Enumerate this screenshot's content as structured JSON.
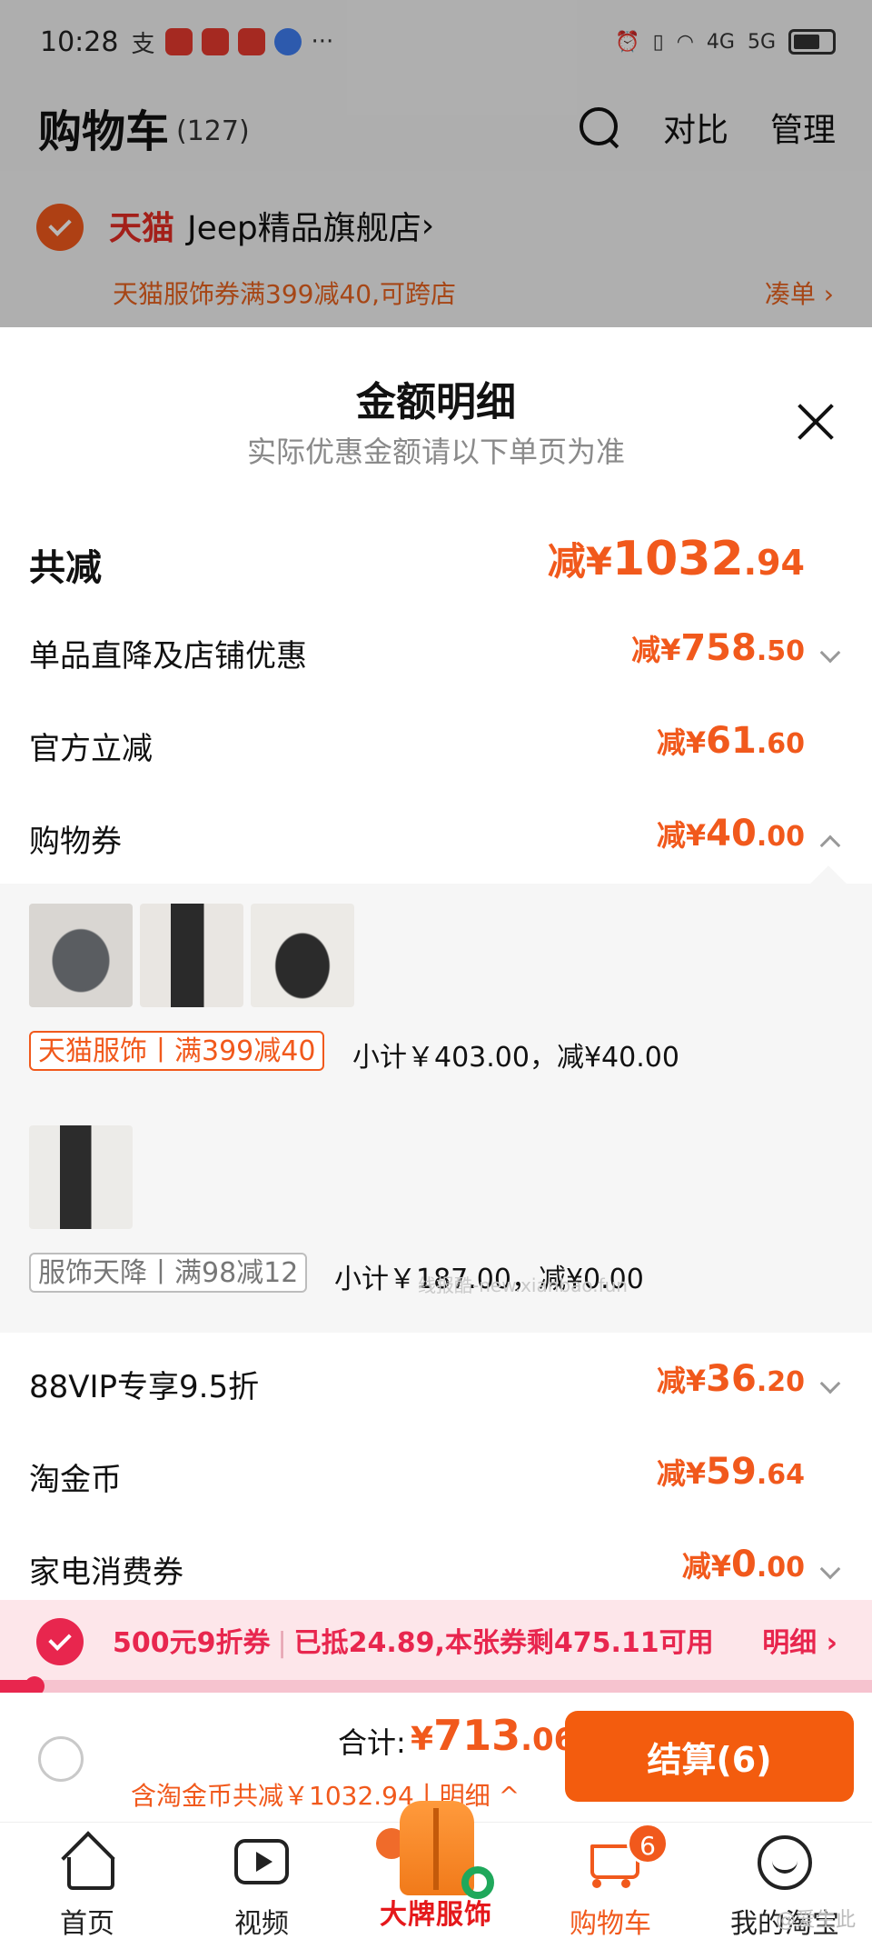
{
  "status_bar": {
    "time": "10:28",
    "pay_icon": "支",
    "more": "···",
    "signal_4g": "4G",
    "signal_5g": "5G"
  },
  "header": {
    "title": "购物车",
    "count": "(127)",
    "compare": "对比",
    "manage": "管理"
  },
  "shop": {
    "brand": "天猫",
    "name": "Jeep精品旗舰店",
    "arrow": "›",
    "coupon_text": "天猫服饰券满399减40,可跨店",
    "coupon_link": "凑单 ›"
  },
  "sheet": {
    "title": "金额明细",
    "subtitle": "实际优惠金额请以下单页为准",
    "total": {
      "label": "共减",
      "prefix": "减¥",
      "int": "1032",
      "dec": ".94"
    },
    "rows": [
      {
        "label": "单品直降及店铺优惠",
        "prefix": "减¥",
        "int": "758",
        "dec": ".50",
        "chevron": "down"
      },
      {
        "label": "官方立减",
        "prefix": "减¥",
        "int": "61",
        "dec": ".60",
        "chevron": "none"
      },
      {
        "label": "购物券",
        "prefix": "减¥",
        "int": "40",
        "dec": ".00",
        "chevron": "up"
      },
      {
        "label": "88VIP专享9.5折",
        "prefix": "减¥",
        "int": "36",
        "dec": ".20",
        "chevron": "down"
      },
      {
        "label": "淘金币",
        "prefix": "减¥",
        "int": "59",
        "dec": ".64",
        "chevron": "none"
      },
      {
        "label": "家电消费券",
        "prefix": "减¥",
        "int": "0",
        "dec": ".00",
        "chevron": "down"
      }
    ],
    "coupon_groups": [
      {
        "tag": "天猫服饰丨满399减40",
        "summary": "小计￥403.00，减¥40.00",
        "products": [
          "jeep-hat",
          "black-skirt-outfit",
          "jeep-neck-warmer"
        ]
      },
      {
        "tag": "服饰天降丨满98减12",
        "summary": "小计￥187.00，减¥0.00",
        "products": [
          "black-skirt-outfit"
        ]
      }
    ],
    "watermark": "线报酷-new.xianbao.fun"
  },
  "promo": {
    "coupon": "500元9折券",
    "detail": "已抵24.89,本张券剩475.11可用",
    "link": "明细 ›",
    "progress": 0.04
  },
  "checkout": {
    "sum_label": "合计:",
    "sum_prefix": "¥",
    "sum_int": "713",
    "sum_dec": ".06",
    "sub": "含淘金币共减￥1032.94丨明细 ^",
    "pay_button": "结算(6)"
  },
  "tabbar": {
    "items": [
      {
        "label": "首页",
        "icon": "home-icon"
      },
      {
        "label": "视频",
        "icon": "video-icon"
      },
      {
        "label": "大牌服饰",
        "icon": "vest-promo-image"
      },
      {
        "label": "购物车",
        "icon": "cart-icon",
        "badge": "6",
        "active": true
      },
      {
        "label": "我的淘宝",
        "icon": "smile-face-icon"
      }
    ]
  },
  "corner_watermark": "@爱生此",
  "colors": {
    "accent": "#f1591c",
    "promo_red": "#e8264e",
    "tmall_red": "#e22d24"
  }
}
